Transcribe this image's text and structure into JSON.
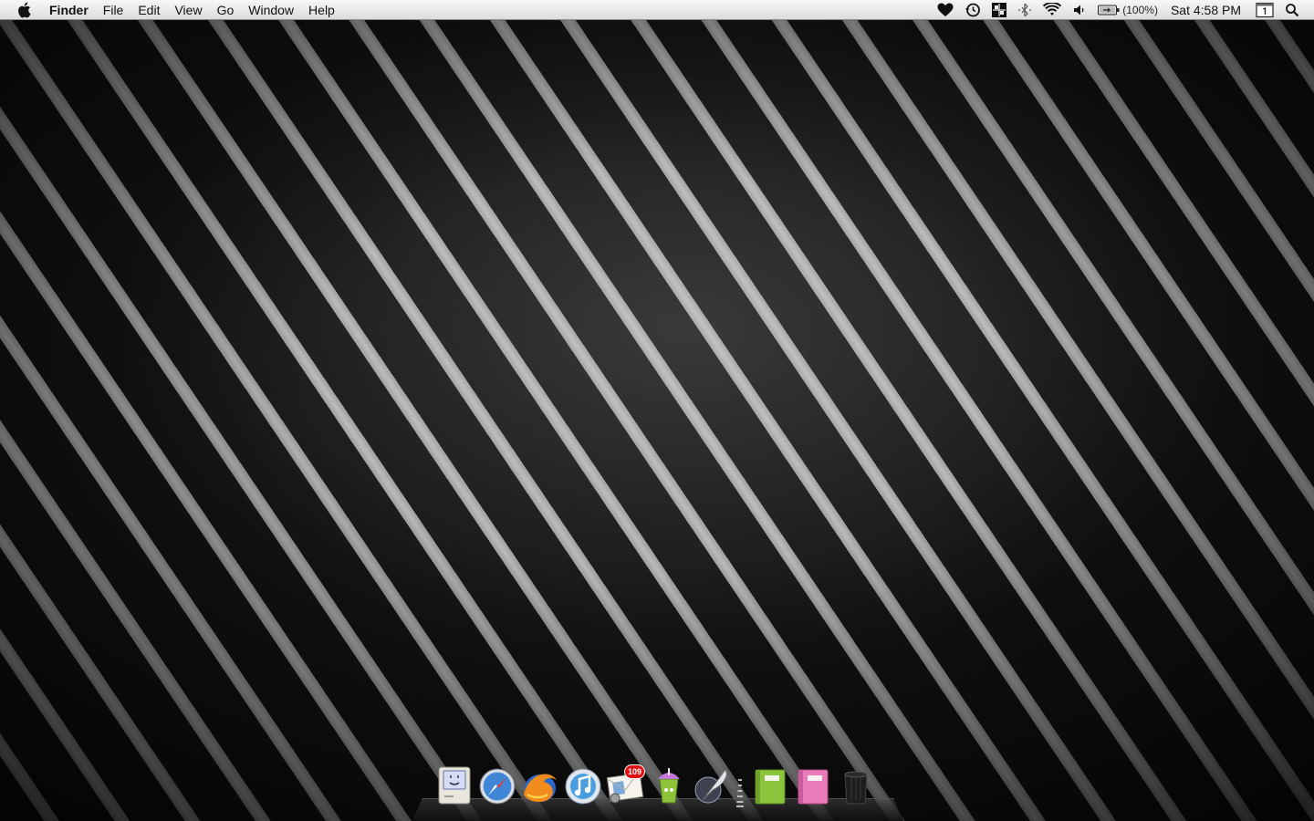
{
  "menubar": {
    "app_name": "Finder",
    "menus": [
      "File",
      "Edit",
      "View",
      "Go",
      "Window",
      "Help"
    ],
    "status_icons": [
      "heart-icon",
      "time-machine-icon",
      "spaces-icon",
      "bluetooth-icon",
      "wifi-icon",
      "volume-icon",
      "battery-icon",
      "calendar-icon",
      "spotlight-icon"
    ],
    "battery_text": "(100%)",
    "clock": "Sat 4:58 PM"
  },
  "desktop": {
    "wallpaper": "black-gray-diagonal-stripes",
    "stripe_color": "#a8a8a8",
    "background_color": "#141414"
  },
  "dock": {
    "items": [
      {
        "icon": "finder-classic-mac-icon"
      },
      {
        "icon": "safari-compass-icon"
      },
      {
        "icon": "firefox-icon"
      },
      {
        "icon": "itunes-icon"
      },
      {
        "icon": "mail-icon",
        "badge": "109"
      },
      {
        "icon": "adium-cup-icon"
      },
      {
        "icon": "quill-pen-icon"
      },
      {
        "icon": "green-notebook-icon"
      },
      {
        "icon": "pink-notebook-icon"
      },
      {
        "icon": "trash-icon"
      }
    ]
  }
}
